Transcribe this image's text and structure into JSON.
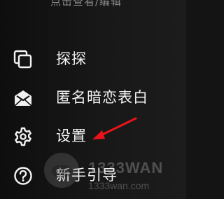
{
  "header": {
    "hint": "点击查看/编辑"
  },
  "menu": {
    "items": [
      {
        "label": "探探",
        "icon": "copy-cards-icon"
      },
      {
        "label": "匿名暗恋表白",
        "icon": "envelope-icon"
      },
      {
        "label": "设置",
        "icon": "gear-icon"
      },
      {
        "label": "新手引导",
        "icon": "question-circle-icon"
      }
    ]
  },
  "annotation": {
    "arrow_color": "#e8141a",
    "arrow_icon": "red-arrow-icon"
  },
  "watermark": {
    "brand": "1333WAN",
    "url": "1333wan.com"
  },
  "colors": {
    "background": "#141414",
    "text": "#f2f2f2"
  }
}
